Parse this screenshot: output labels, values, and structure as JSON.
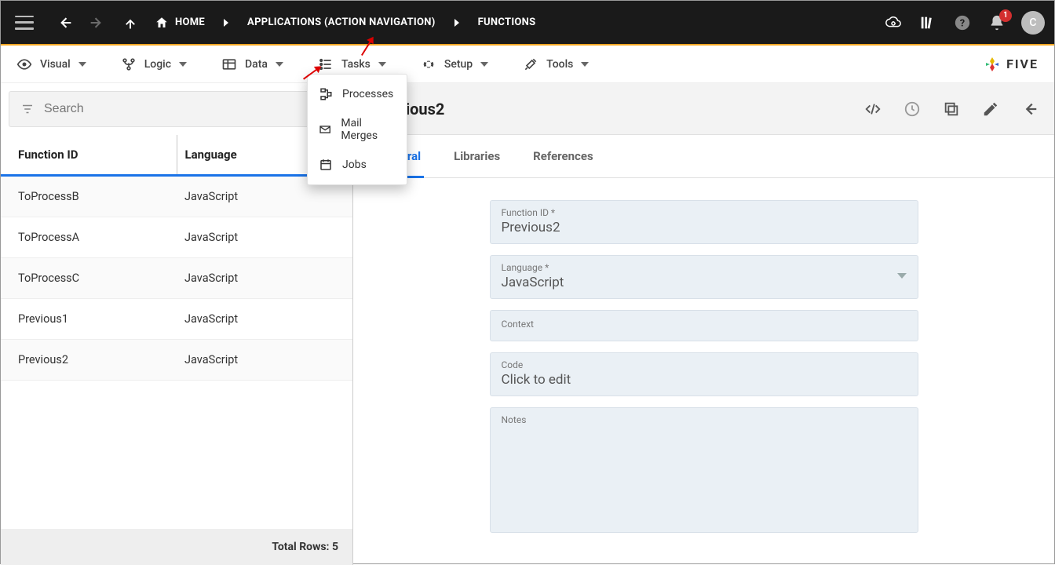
{
  "topbar": {
    "home": "HOME",
    "breadcrumbs": [
      "APPLICATIONS (ACTION NAVIGATION)",
      "FUNCTIONS"
    ],
    "notification_count": "1",
    "avatar_letter": "C"
  },
  "menu": {
    "items": [
      {
        "label": "Visual"
      },
      {
        "label": "Logic"
      },
      {
        "label": "Data"
      },
      {
        "label": "Tasks"
      },
      {
        "label": "Setup"
      },
      {
        "label": "Tools"
      }
    ],
    "brand": "FIVE"
  },
  "dropdown": {
    "items": [
      {
        "label": "Processes"
      },
      {
        "label": "Mail Merges"
      },
      {
        "label": "Jobs"
      }
    ]
  },
  "search": {
    "placeholder": "Search"
  },
  "table": {
    "headers": [
      "Function ID",
      "Language"
    ],
    "rows": [
      {
        "id": "ToProcessB",
        "lang": "JavaScript"
      },
      {
        "id": "ToProcessA",
        "lang": "JavaScript"
      },
      {
        "id": "ToProcessC",
        "lang": "JavaScript"
      },
      {
        "id": "Previous1",
        "lang": "JavaScript"
      },
      {
        "id": "Previous2",
        "lang": "JavaScript"
      }
    ],
    "footer_label": "Total Rows: 5"
  },
  "detail": {
    "title": "Previous2",
    "tabs": [
      "General",
      "Libraries",
      "References"
    ],
    "fields": {
      "function_id_label": "Function ID *",
      "function_id_value": "Previous2",
      "language_label": "Language *",
      "language_value": "JavaScript",
      "context_label": "Context",
      "code_label": "Code",
      "code_value": "Click to edit",
      "notes_label": "Notes"
    }
  }
}
